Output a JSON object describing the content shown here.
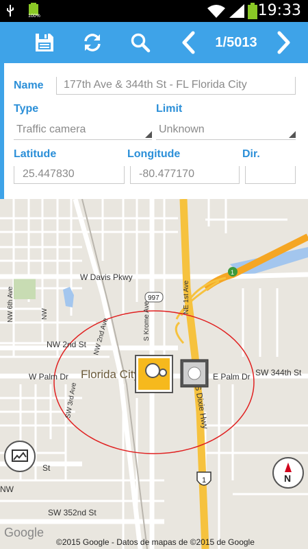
{
  "statusbar": {
    "time": "19:33",
    "battery_label": "100%"
  },
  "toolbar": {
    "counter": "1/5013"
  },
  "form": {
    "name_label": "Name",
    "name_value": "177th Ave & 344th St - FL Florida City",
    "type_label": "Type",
    "type_value": "Traffic camera",
    "limit_label": "Limit",
    "limit_value": "Unknown",
    "latitude_label": "Latitude",
    "latitude_value": "25.447830",
    "longitude_label": "Longitude",
    "longitude_value": "-80.477170",
    "dir_label": "Dir.",
    "dir_value": ""
  },
  "map": {
    "streets": {
      "w_davis": "W Davis Pkwy",
      "nw2nd": "NW 2nd St",
      "wpalm": "W Palm Dr",
      "epalm": "E Palm Dr",
      "sw344": "SW 344th St",
      "sw352": "SW 352nd St",
      "st": "St",
      "sw3rd": "SW 3rd Ave",
      "nw2nd_ave": "NW 2nd Ave",
      "nw6th": "NW 6th Ave",
      "skrome": "S Krome Ave",
      "ne1st": "NE 1st Ave",
      "sdixie": "S Dixie Hwy",
      "nw": "NW"
    },
    "city": "Florida City",
    "shield_997": "997",
    "shield_1": "1",
    "shield_1b": "1",
    "compass_letter": "N",
    "google": "Google",
    "attribution": "©2015 Google - Datos de mapas de ©2015 de Google"
  },
  "colors": {
    "accent": "#3ea3e8",
    "highway": "#f6c23e",
    "circle": "#e02020"
  }
}
